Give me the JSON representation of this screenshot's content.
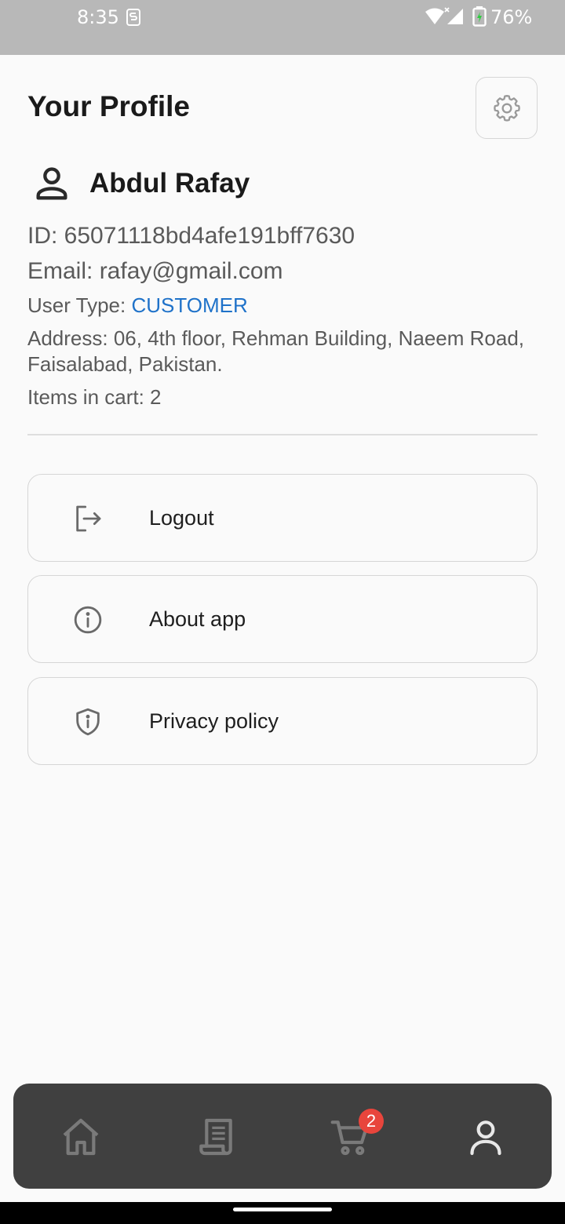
{
  "status_bar": {
    "time": "8:35",
    "battery": "76%",
    "icons": [
      "s-icon",
      "wifi-icon",
      "signal-icon",
      "battery-charging-icon"
    ]
  },
  "header": {
    "title": "Your Profile",
    "settings_icon": "gear-icon"
  },
  "profile": {
    "name": "Abdul Rafay",
    "avatar_icon": "person-icon",
    "id_label": "ID: ",
    "id_value": "65071118bd4afe191bff7630",
    "email_label": "Email: ",
    "email_value": "rafay@gmail.com",
    "user_type_label": "User Type: ",
    "user_type_value": "CUSTOMER",
    "address_label": "Address: ",
    "address_value": "06, 4th floor, Rehman Building, Naeem Road, Faisalabad, Pakistan.",
    "cart_label": "Items in cart: ",
    "cart_value": "2"
  },
  "menu": [
    {
      "label": "Logout",
      "icon": "logout-icon"
    },
    {
      "label": "About app",
      "icon": "info-icon"
    },
    {
      "label": "Privacy policy",
      "icon": "shield-icon"
    }
  ],
  "bottom_nav": {
    "items": [
      {
        "icon": "home-icon",
        "active": false
      },
      {
        "icon": "receipt-icon",
        "active": false
      },
      {
        "icon": "cart-icon",
        "active": false
      },
      {
        "icon": "profile-icon",
        "active": true
      }
    ],
    "cart_badge": "2"
  },
  "colors": {
    "accent": "#1f72c9",
    "nav_background": "#404040",
    "badge": "#e8453c",
    "status_bar": "#b8b8b8"
  }
}
